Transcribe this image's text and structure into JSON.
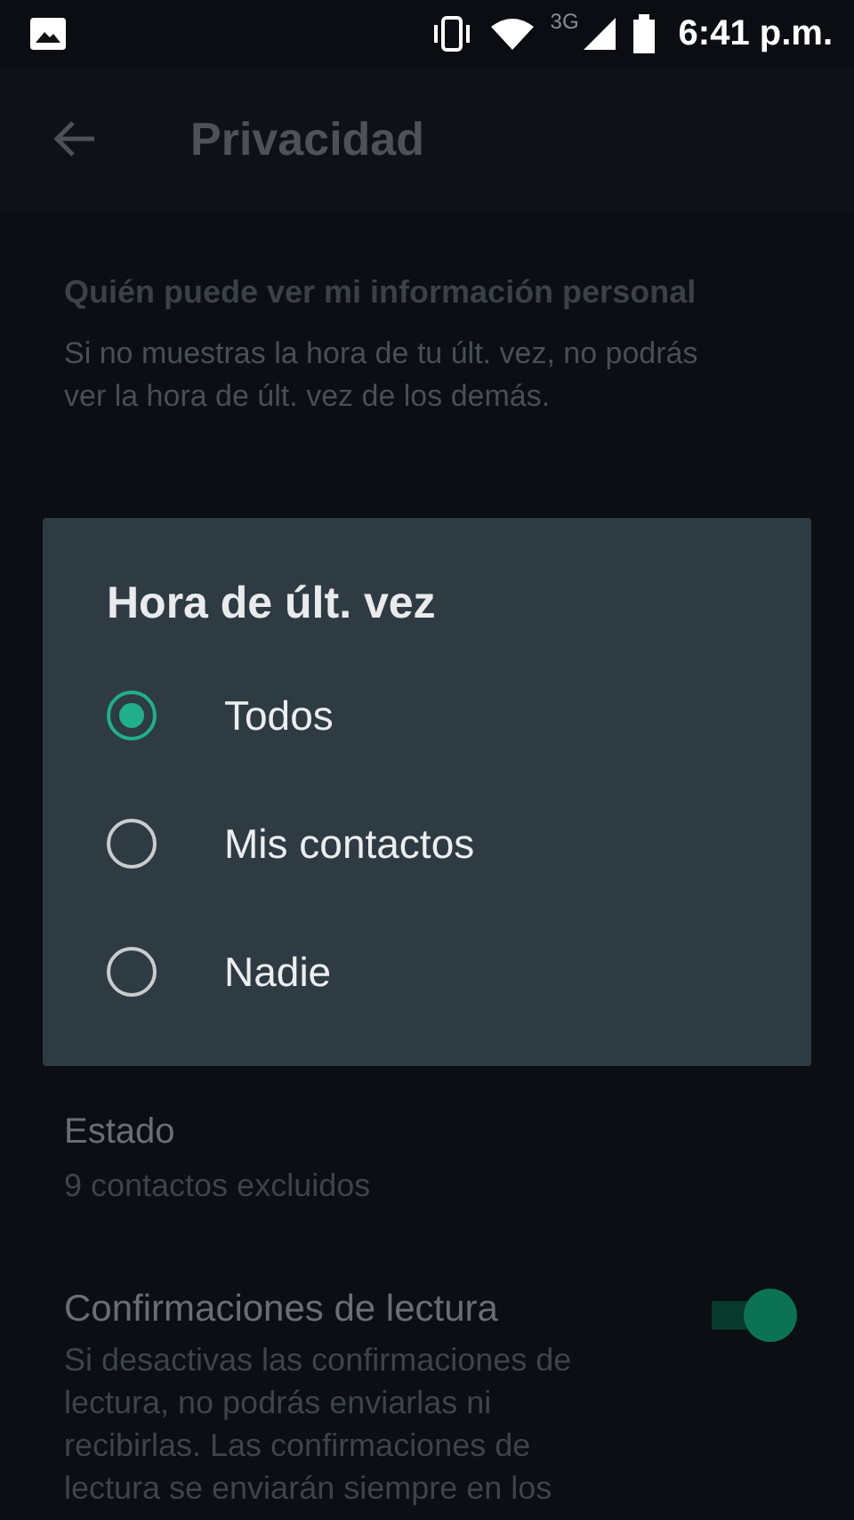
{
  "status_bar": {
    "time": "6:41 p.m.",
    "network": "3G"
  },
  "app_bar": {
    "title": "Privacidad"
  },
  "section": {
    "title": "Quién puede ver mi información personal",
    "description": "Si no muestras la hora de tu últ. vez, no podrás ver la hora de últ. vez de los demás."
  },
  "settings": [
    {
      "kind": "text",
      "title": "Estado",
      "subtitle": "9 contactos excluidos"
    },
    {
      "kind": "switch",
      "title": "Confirmaciones de lectura",
      "subtitle": "Si desactivas las confirmaciones de lectura, no podrás enviarlas ni recibirlas. Las confirmaciones de lectura se enviarán siempre en los",
      "on": true
    }
  ],
  "dialog": {
    "title": "Hora de últ. vez",
    "options": [
      {
        "label": "Todos",
        "selected": true
      },
      {
        "label": "Mis contactos",
        "selected": false
      },
      {
        "label": "Nadie",
        "selected": false
      }
    ]
  }
}
